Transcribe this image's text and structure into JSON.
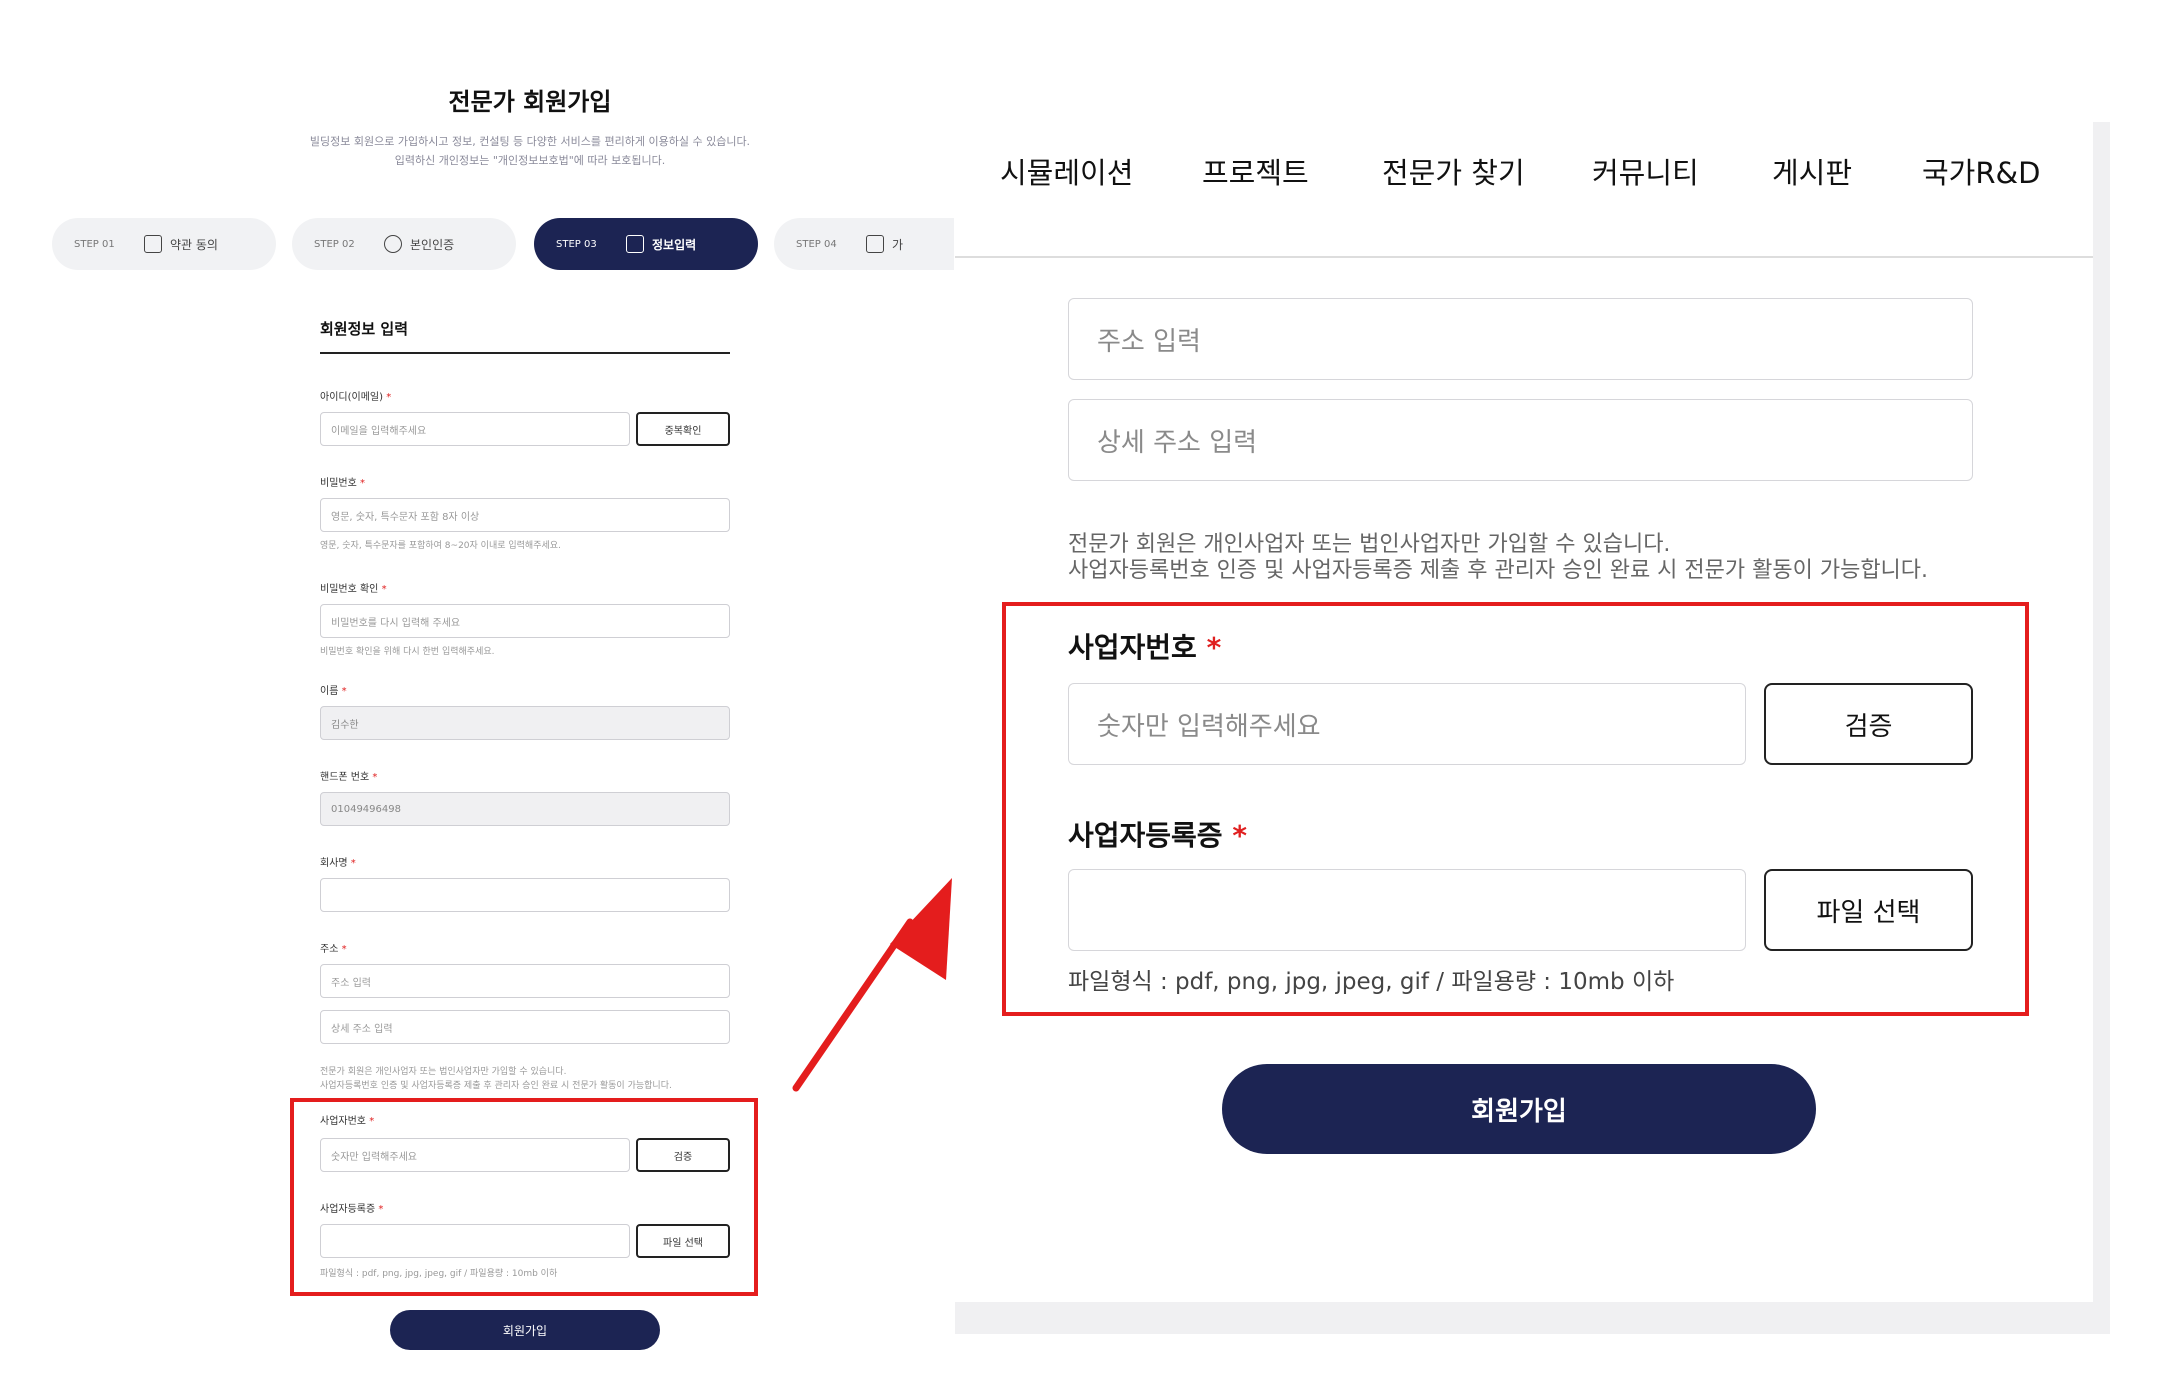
{
  "left": {
    "title": "전문가 회원가입",
    "description": [
      "빌딩정보 회원으로 가입하시고 정보, 컨설팅 등 다양한 서비스를 편리하게 이용하실 수 있습니다.",
      "입력하신 개인정보는 \"개인정보보호법\"에 따라 보호됩니다."
    ],
    "steps": [
      {
        "num": "STEP 01",
        "label": "약관 동의"
      },
      {
        "num": "STEP 02",
        "label": "본인인증"
      },
      {
        "num": "STEP 03",
        "label": "정보입력"
      },
      {
        "num": "STEP 04",
        "label": "가"
      }
    ],
    "form_heading": "회원정보 입력",
    "fields": {
      "id_label": "아이디(이메일)",
      "id_placeholder": "이메일을 입력해주세요",
      "dup_check": "중복확인",
      "pw_label": "비밀번호",
      "pw_placeholder": "영문, 숫자, 특수문자 포함 8자 이상",
      "pw_hint": "영문, 숫자, 특수문자를 포함하여 8~20자 이내로 입력해주세요.",
      "pw_confirm_label": "비밀번호 확인",
      "pw_confirm_placeholder": "비밀번호를 다시 입력해 주세요",
      "pw_confirm_hint": "비밀번호 확인을 위해 다시 한번 입력해주세요.",
      "name_label": "이름",
      "name_value": "김수한",
      "phone_label": "핸드폰 번호",
      "phone_value": "01049496498",
      "company_label": "회사명",
      "address_label": "주소",
      "address_placeholder": "주소 입력",
      "address_detail_placeholder": "상세 주소 입력",
      "expert_notice": [
        "전문가 회원은 개인사업자 또는 법인사업자만 가입할 수 있습니다.",
        "사업자등록번호 인증 및 사업자등록증 제출 후 관리자 승인 완료 시 전문가 활동이 가능합니다."
      ],
      "biz_num_label": "사업자번호",
      "biz_num_placeholder": "숫자만 입력해주세요",
      "verify_button": "검증",
      "biz_cert_label": "사업자등록증",
      "file_button": "파일 선택",
      "file_hint": "파일형식 : pdf, png, jpg, jpeg, gif / 파일용량 : 10mb 이하"
    },
    "submit": "회원가입"
  },
  "zoom": {
    "nav": [
      "시뮬레이션",
      "프로젝트",
      "전문가 찾기",
      "커뮤니티",
      "게시판",
      "국가R&D"
    ],
    "address_placeholder": "주소 입력",
    "address_detail_placeholder": "상세 주소 입력",
    "expert_notice": [
      "전문가 회원은 개인사업자 또는 법인사업자만 가입할 수 있습니다.",
      "사업자등록번호 인증 및 사업자등록증 제출 후 관리자 승인 완료 시 전문가 활동이 가능합니다."
    ],
    "biz_num_label": "사업자번호",
    "biz_num_placeholder": "숫자만 입력해주세요",
    "verify_button": "검증",
    "biz_cert_label": "사업자등록증",
    "file_button": "파일 선택",
    "file_hint": "파일형식 : pdf, png, jpg, jpeg, gif / 파일용량 : 10mb 이하",
    "submit": "회원가입"
  },
  "required_mark": "*",
  "colors": {
    "navy": "#1c2453",
    "highlight_red": "#e41d1d",
    "required_red": "#e02020"
  },
  "icons": [
    "document-icon",
    "id-card-icon",
    "form-edit-icon",
    "clipboard-icon",
    "arrow-icon"
  ]
}
